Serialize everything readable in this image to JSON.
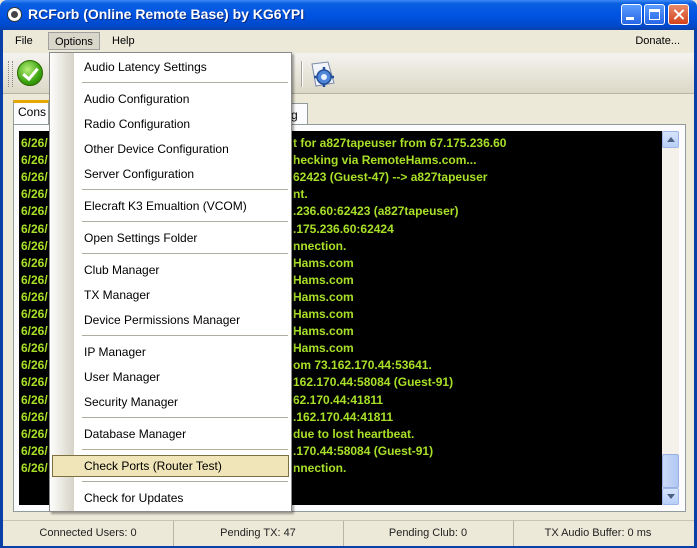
{
  "window": {
    "title": "RCForb (Online Remote Base) by KG6YPI"
  },
  "menubar": {
    "file": "File",
    "options": "Options",
    "help": "Help",
    "donate": "Donate..."
  },
  "tabs": [
    {
      "label": "Cons"
    },
    {
      "label": "g"
    }
  ],
  "console": {
    "left_lines": [
      "6/26/",
      "6/26/",
      "6/26/",
      "6/26/",
      "6/26/",
      "6/26/",
      "6/26/",
      "6/26/",
      "6/26/",
      "6/26/",
      "6/26/",
      "6/26/",
      "6/26/",
      "6/26/",
      "6/26/",
      "6/26/",
      "6/26/",
      "6/26/",
      "6/26/",
      "6/26/"
    ],
    "right_lines": [
      "t for a827tapeuser from 67.175.236.60",
      "hecking via RemoteHams.com...",
      "62423 (Guest-47) --> a827tapeuser",
      "nt.",
      ".236.60:62423 (a827tapeuser)",
      ".175.236.60:62424",
      "nnection.",
      "Hams.com",
      "Hams.com",
      "Hams.com",
      "Hams.com",
      "Hams.com",
      "Hams.com",
      "om 73.162.170.44:53641.",
      "162.170.44:58084 (Guest-91)",
      "62.170.44:41811",
      ".162.170.44:41811",
      "due to lost heartbeat.",
      ".170.44:58084 (Guest-91)",
      "nnection."
    ]
  },
  "options_menu": {
    "items": [
      "Audio Latency Settings",
      "Audio Configuration",
      "Radio Configuration",
      "Other Device Configuration",
      "Server Configuration",
      "Elecraft K3 Emualtion (VCOM)",
      "Open Settings Folder",
      "Club Manager",
      "TX Manager",
      "Device Permissions Manager",
      "IP Manager",
      "User Manager",
      "Security Manager",
      "Database Manager",
      "Check Ports (Router Test)",
      "Check for Updates"
    ],
    "highlighted": "Check Ports (Router Test)"
  },
  "statusbar": {
    "connected_users": "Connected Users: 0",
    "pending_tx": "Pending TX: 47",
    "pending_club": "Pending Club: 0",
    "tx_audio_buffer": "TX Audio Buffer: 0 ms"
  },
  "colors": {
    "console_text": "#a8e028",
    "console_bg": "#000000",
    "titlebar": "#0054e3",
    "menu_highlight": "#efe5b8"
  }
}
